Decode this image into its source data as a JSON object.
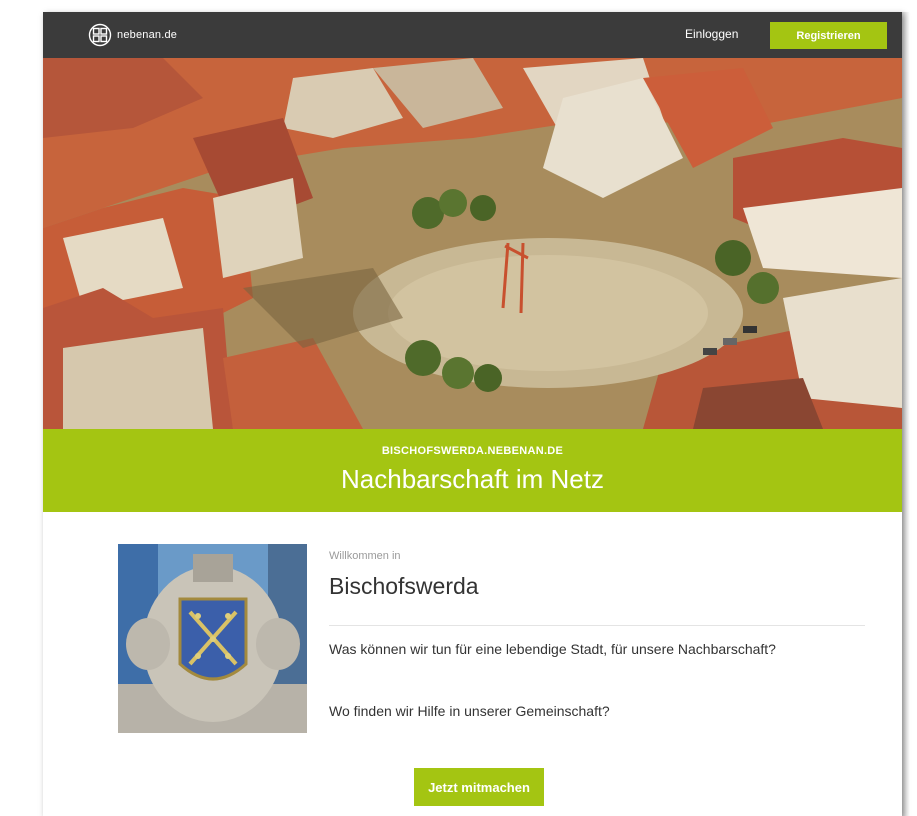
{
  "nav": {
    "logo_text": "nebenan.de",
    "login_label": "Einloggen",
    "register_label": "Registrieren"
  },
  "hero": {
    "image": "aerial-town-square-photo"
  },
  "banner": {
    "domain": "BISCHOFSWERDA.NEBENAN.DE",
    "title": "Nachbarschaft im Netz"
  },
  "content": {
    "crest_image": "town-coat-of-arms-photo",
    "welcome_prefix": "Willkommen in",
    "town_name": "Bischofswerda",
    "intro_1": "Was können wir tun für eine lebendige Stadt, für unsere Nachbarschaft?",
    "intro_2": "Wo finden wir Hilfe in unserer Gemeinschaft?",
    "cta_label": "Jetzt mitmachen"
  },
  "colors": {
    "brand_green": "#a4c512",
    "navbar": "#3b3b3b"
  }
}
